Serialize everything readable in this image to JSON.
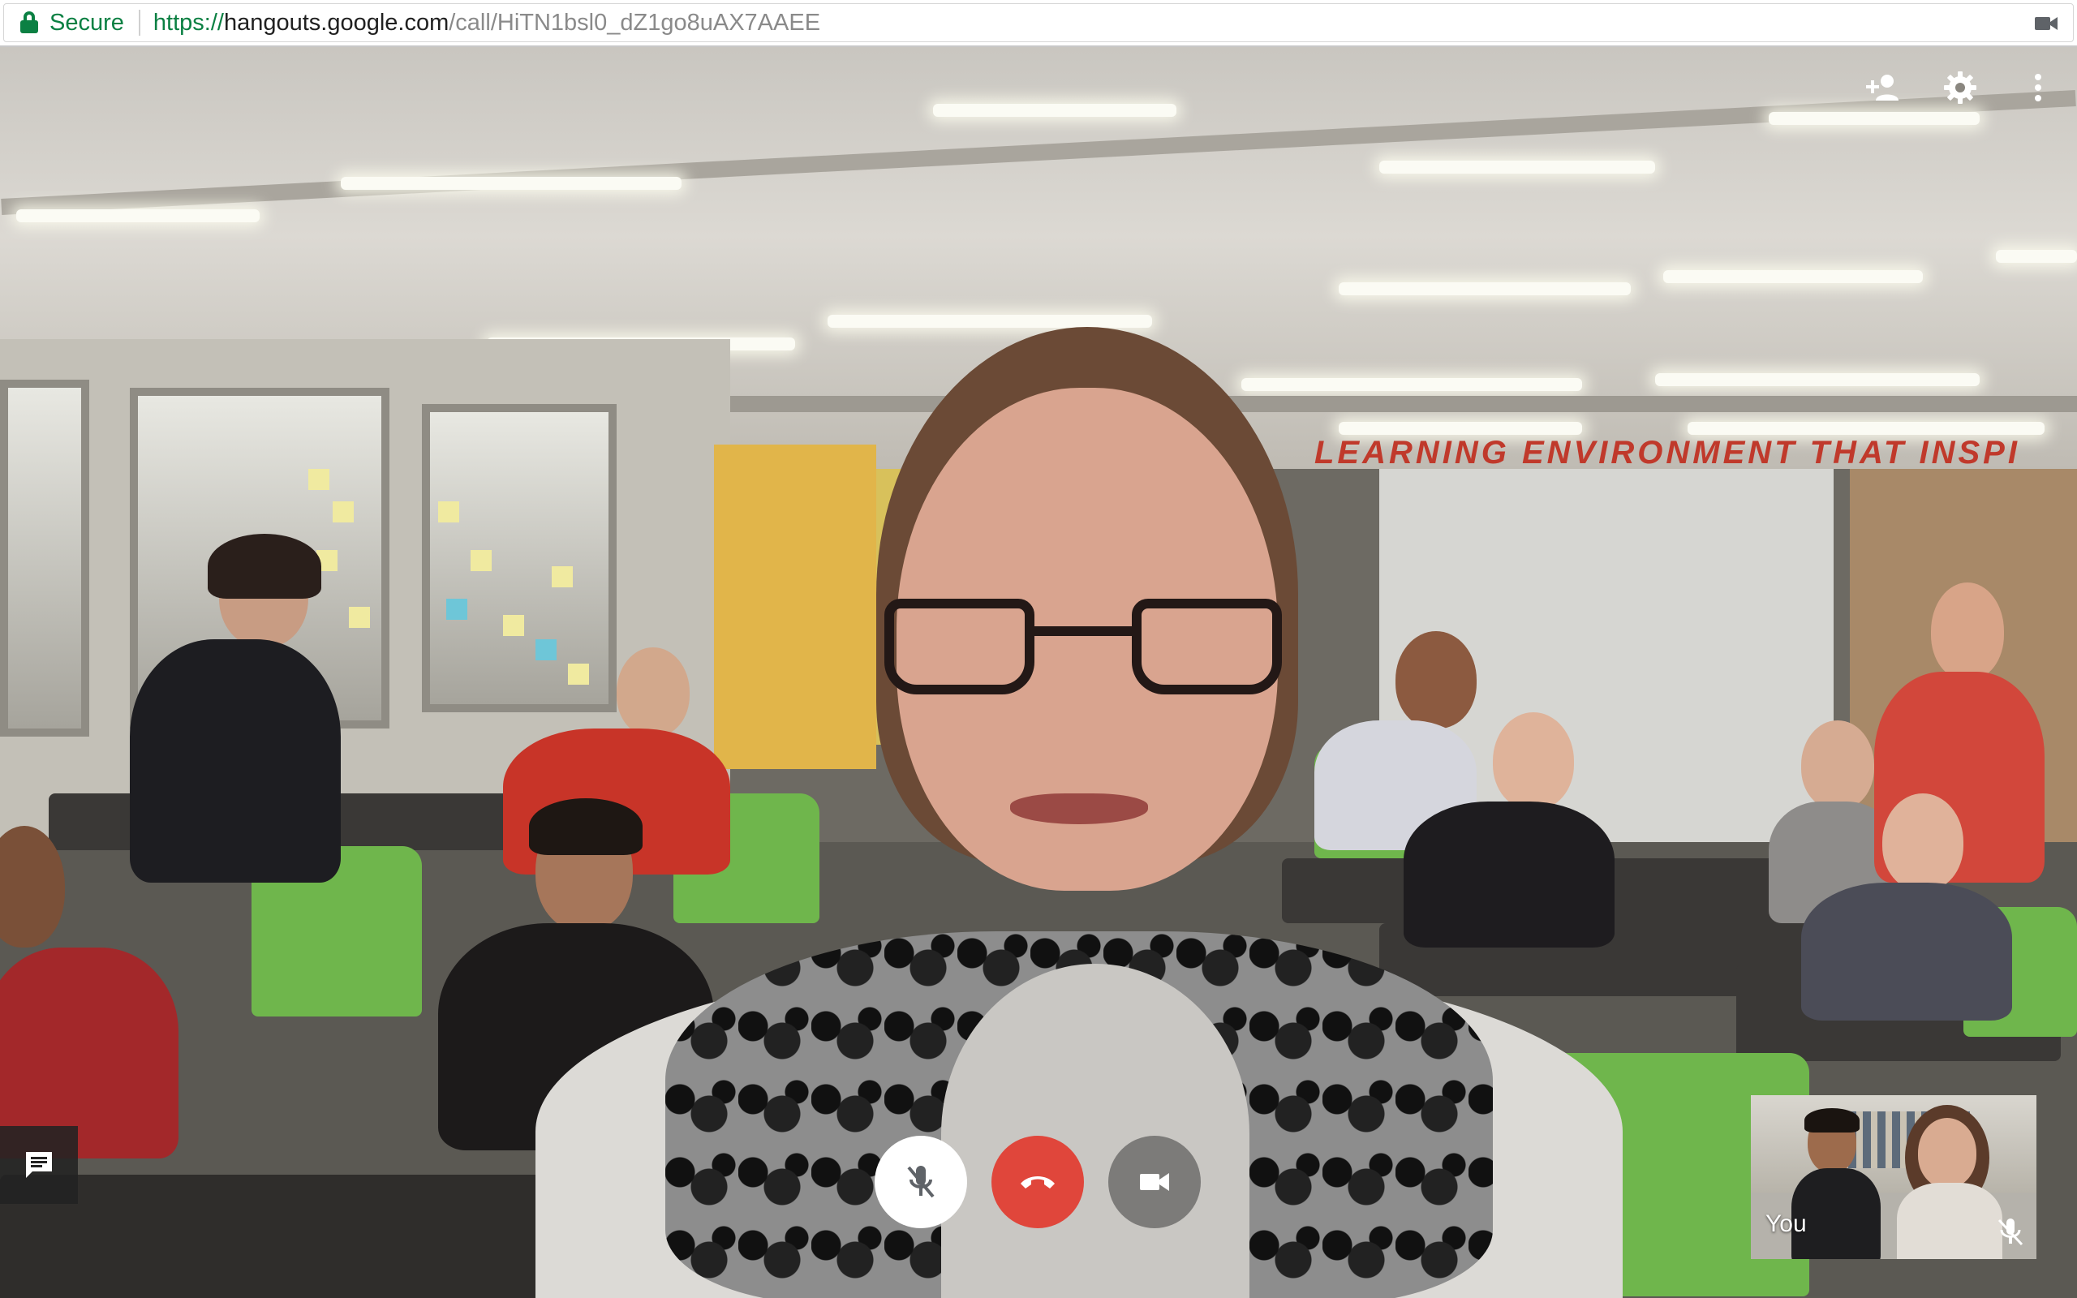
{
  "address_bar": {
    "secure_label": "Secure",
    "url_scheme": "https://",
    "url_host": "hangouts.google.com",
    "url_path": "/call/HiTN1bsl0_dZ1go8uAX7AAEE"
  },
  "scene": {
    "banner": "LEARNING ENVIRONMENT  THAT INSPI"
  },
  "top_controls": [
    {
      "icon": "add-person-icon"
    },
    {
      "icon": "gear-icon"
    },
    {
      "icon": "more-vert-icon"
    }
  ],
  "bottom_controls": {
    "mic_icon": "mic-off-icon",
    "end_icon": "hang-up-icon",
    "camera_icon": "videocam-icon"
  },
  "chat_button": {
    "icon": "chat-icon"
  },
  "self_view": {
    "label": "You",
    "mute_icon": "mic-off-icon"
  },
  "colors": {
    "secure_green": "#0b8043",
    "hangup_red": "#e0463b"
  }
}
